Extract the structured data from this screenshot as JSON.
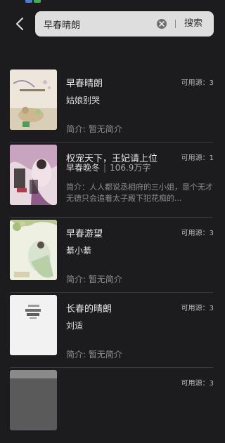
{
  "search": {
    "query": "早春晴朗",
    "button_label": "搜索"
  },
  "sources_label": "可用源：",
  "books": [
    {
      "title": "早春晴朗",
      "author": "姑娘别哭",
      "words": "",
      "intro": "简介: 暂无简介",
      "sources": "3"
    },
    {
      "title": "权宠天下，王妃请上位",
      "author": "早春晚冬",
      "words": "106.9万字",
      "intro": "简介：人人都说丞相府的三小姐，是个无才无德只会追着太子殿下犯花痴的...",
      "sources": "1"
    },
    {
      "title": "早春游望",
      "author": "綦小綦",
      "words": "",
      "intro": "简介: 暂无简介",
      "sources": "3"
    },
    {
      "title": "长春的晴朗",
      "author": "刘适",
      "words": "",
      "intro": "简介: 暂无简介",
      "sources": "3"
    },
    {
      "title": "",
      "author": "",
      "words": "",
      "intro": "",
      "sources": "3"
    }
  ],
  "colors": {
    "background": "#1c1c1e",
    "search_box": "#dedede",
    "divider": "#3a3a3c"
  }
}
